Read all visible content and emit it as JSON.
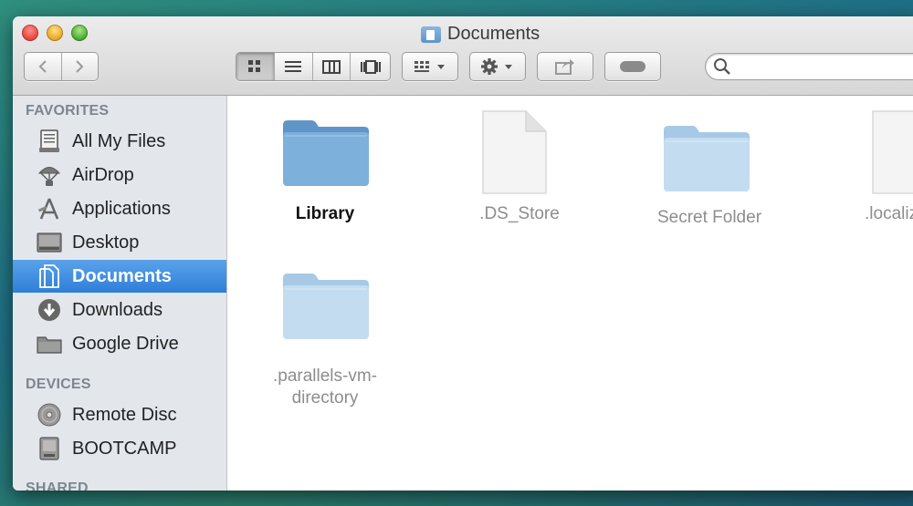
{
  "window": {
    "title": "Documents"
  },
  "toolbar": {
    "back_icon": "chevron-left-icon",
    "forward_icon": "chevron-right-icon",
    "view_modes": [
      "icon-view-icon",
      "list-view-icon",
      "column-view-icon",
      "coverflow-view-icon"
    ],
    "active_view": "icon-view-icon",
    "arrange_icon": "arrange-icon",
    "action_icon": "gear-icon",
    "share_icon": "share-icon",
    "tags_icon": "tag-pill-icon",
    "search": {
      "value": "",
      "placeholder": "",
      "icon": "search-icon"
    }
  },
  "sidebar": {
    "sections": [
      {
        "title": "FAVORITES",
        "items": [
          {
            "label": "All My Files",
            "icon": "all-files-icon"
          },
          {
            "label": "AirDrop",
            "icon": "airdrop-icon"
          },
          {
            "label": "Applications",
            "icon": "applications-icon"
          },
          {
            "label": "Desktop",
            "icon": "desktop-icon"
          },
          {
            "label": "Documents",
            "icon": "documents-icon",
            "selected": true
          },
          {
            "label": "Downloads",
            "icon": "downloads-icon"
          },
          {
            "label": "Google Drive",
            "icon": "folder-icon"
          }
        ]
      },
      {
        "title": "DEVICES",
        "items": [
          {
            "label": "Remote Disc",
            "icon": "disc-icon"
          },
          {
            "label": "BOOTCAMP",
            "icon": "drive-icon"
          }
        ]
      },
      {
        "title": "SHARED",
        "items": []
      }
    ]
  },
  "files": [
    {
      "name": "Library",
      "kind": "folder",
      "hidden": false
    },
    {
      "name": ".DS_Store",
      "kind": "document",
      "hidden": true
    },
    {
      "name": "Secret Folder",
      "kind": "folder",
      "hidden": true
    },
    {
      "name": ".localiz",
      "kind": "document",
      "hidden": true
    },
    {
      "name": ".parallels-vm-",
      "name_line2": "directory",
      "kind": "folder",
      "hidden": true
    }
  ],
  "colors": {
    "selection": "#2f7fd8",
    "hidden_text": "#8d8d8d",
    "folder": "#6a9fcf",
    "folder_hidden": "#b7d3ea"
  }
}
